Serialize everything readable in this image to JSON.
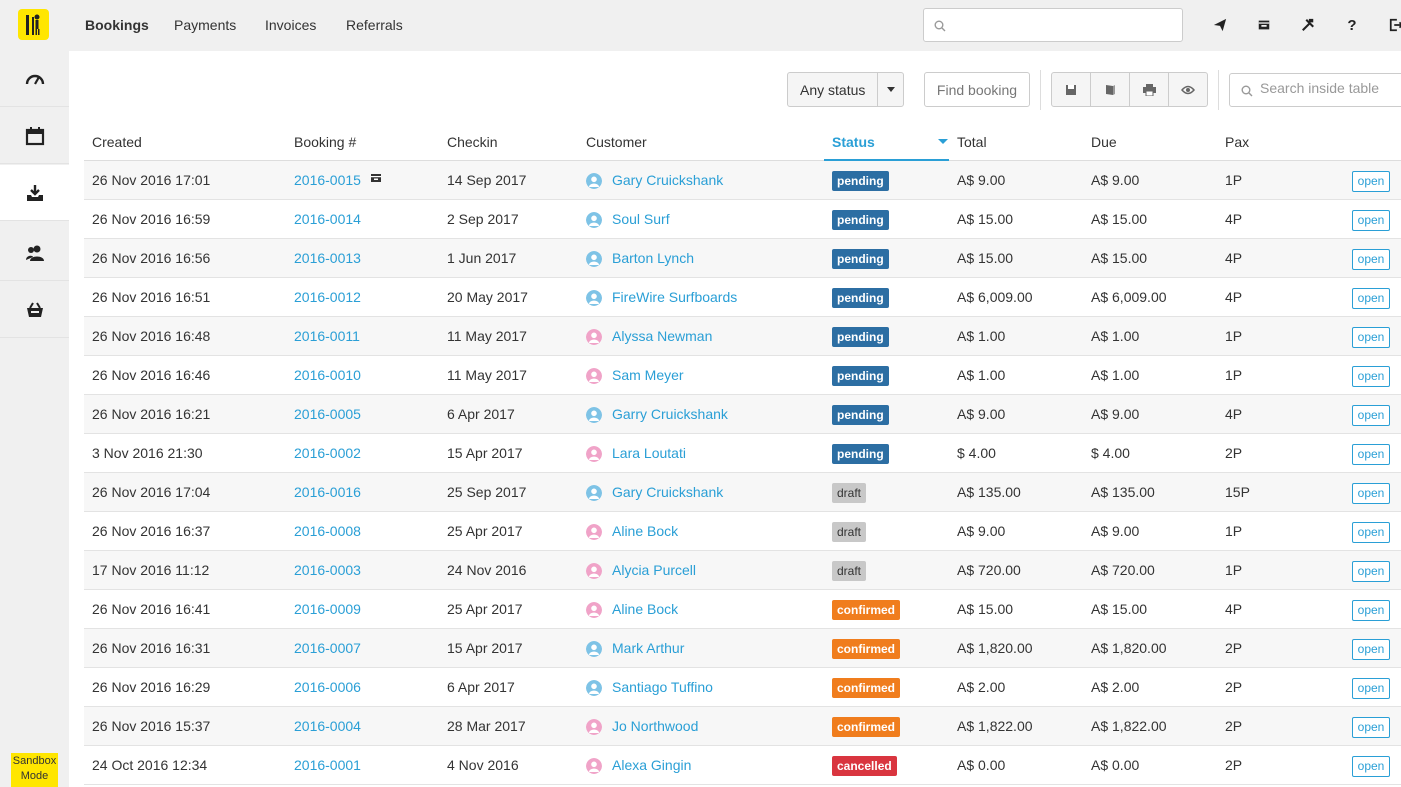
{
  "sidebar": {
    "items": [
      {
        "icon": "dashboard-gauge-icon"
      },
      {
        "icon": "calendar-icon"
      },
      {
        "icon": "inbox-download-icon"
      },
      {
        "icon": "users-icon"
      },
      {
        "icon": "store-basket-icon"
      }
    ],
    "sandbox_line1": "Sandbox",
    "sandbox_line2": "Mode"
  },
  "nav": {
    "tabs": [
      "Bookings",
      "Payments",
      "Invoices",
      "Referrals"
    ],
    "active": "Bookings",
    "help_label": "?"
  },
  "toolbar": {
    "status_filter": "Any status",
    "find_booking": "Find booking",
    "search_placeholder": "Search inside table"
  },
  "table": {
    "columns": [
      "Created",
      "Booking #",
      "Checkin",
      "Customer",
      "Status",
      "Total",
      "Due",
      "Pax"
    ],
    "sorted_column": "Status",
    "rows": [
      {
        "created": "26 Nov 2016  17:01",
        "booking": "2016-0015",
        "checkin": "14 Sep 2017",
        "customer": "Gary Cruickshank",
        "gender": "male",
        "status": "pending",
        "total": "A$ 9.00",
        "due": "A$ 9.00",
        "pax": "1P",
        "action": "open",
        "store_icon": true
      },
      {
        "created": "26 Nov 2016  16:59",
        "booking": "2016-0014",
        "checkin": "2 Sep 2017",
        "customer": "Soul Surf",
        "gender": "male",
        "status": "pending",
        "total": "A$ 15.00",
        "due": "A$ 15.00",
        "pax": "4P",
        "action": "open"
      },
      {
        "created": "26 Nov 2016  16:56",
        "booking": "2016-0013",
        "checkin": "1 Jun 2017",
        "customer": "Barton Lynch",
        "gender": "male",
        "status": "pending",
        "total": "A$ 15.00",
        "due": "A$ 15.00",
        "pax": "4P",
        "action": "open"
      },
      {
        "created": "26 Nov 2016  16:51",
        "booking": "2016-0012",
        "checkin": "20 May 2017",
        "customer": "FireWire Surfboards",
        "gender": "male",
        "status": "pending",
        "total": "A$ 6,009.00",
        "due": "A$ 6,009.00",
        "pax": "4P",
        "action": "open"
      },
      {
        "created": "26 Nov 2016  16:48",
        "booking": "2016-0011",
        "checkin": "11 May 2017",
        "customer": "Alyssa Newman",
        "gender": "female",
        "status": "pending",
        "total": "A$ 1.00",
        "due": "A$ 1.00",
        "pax": "1P",
        "action": "open"
      },
      {
        "created": "26 Nov 2016  16:46",
        "booking": "2016-0010",
        "checkin": "11 May 2017",
        "customer": "Sam Meyer",
        "gender": "female",
        "status": "pending",
        "total": "A$ 1.00",
        "due": "A$ 1.00",
        "pax": "1P",
        "action": "open"
      },
      {
        "created": "26 Nov 2016  16:21",
        "booking": "2016-0005",
        "checkin": "6 Apr 2017",
        "customer": "Garry Cruickshank",
        "gender": "male",
        "status": "pending",
        "total": "A$ 9.00",
        "due": "A$ 9.00",
        "pax": "4P",
        "action": "open"
      },
      {
        "created": "3 Nov 2016  21:30",
        "booking": "2016-0002",
        "checkin": "15 Apr 2017",
        "customer": "Lara Loutati",
        "gender": "female",
        "status": "pending",
        "total": "$ 4.00",
        "due": "$ 4.00",
        "pax": "2P",
        "action": "open"
      },
      {
        "created": "26 Nov 2016  17:04",
        "booking": "2016-0016",
        "checkin": "25 Sep 2017",
        "customer": "Gary Cruickshank",
        "gender": "male",
        "status": "draft",
        "total": "A$ 135.00",
        "due": "A$ 135.00",
        "pax": "15P",
        "action": "open"
      },
      {
        "created": "26 Nov 2016  16:37",
        "booking": "2016-0008",
        "checkin": "25 Apr 2017",
        "customer": "Aline Bock",
        "gender": "female",
        "status": "draft",
        "total": "A$ 9.00",
        "due": "A$ 9.00",
        "pax": "1P",
        "action": "open"
      },
      {
        "created": "17 Nov 2016  11:12",
        "booking": "2016-0003",
        "checkin": "24 Nov 2016",
        "customer": "Alycia Purcell",
        "gender": "female",
        "status": "draft",
        "total": "A$ 720.00",
        "due": "A$ 720.00",
        "pax": "1P",
        "action": "open"
      },
      {
        "created": "26 Nov 2016  16:41",
        "booking": "2016-0009",
        "checkin": "25 Apr 2017",
        "customer": "Aline Bock",
        "gender": "female",
        "status": "confirmed",
        "total": "A$ 15.00",
        "due": "A$ 15.00",
        "pax": "4P",
        "action": "open"
      },
      {
        "created": "26 Nov 2016  16:31",
        "booking": "2016-0007",
        "checkin": "15 Apr 2017",
        "customer": "Mark Arthur",
        "gender": "male",
        "status": "confirmed",
        "total": "A$ 1,820.00",
        "due": "A$ 1,820.00",
        "pax": "2P",
        "action": "open"
      },
      {
        "created": "26 Nov 2016  16:29",
        "booking": "2016-0006",
        "checkin": "6 Apr 2017",
        "customer": "Santiago Tuffino",
        "gender": "male",
        "status": "confirmed",
        "total": "A$ 2.00",
        "due": "A$ 2.00",
        "pax": "2P",
        "action": "open"
      },
      {
        "created": "26 Nov 2016  15:37",
        "booking": "2016-0004",
        "checkin": "28 Mar 2017",
        "customer": "Jo Northwood",
        "gender": "female",
        "status": "confirmed",
        "total": "A$ 1,822.00",
        "due": "A$ 1,822.00",
        "pax": "2P",
        "action": "open"
      },
      {
        "created": "24 Oct 2016  12:34",
        "booking": "2016-0001",
        "checkin": "4 Nov 2016",
        "customer": "Alexa Gingin",
        "gender": "female",
        "status": "cancelled",
        "total": "A$ 0.00",
        "due": "A$ 0.00",
        "pax": "2P",
        "action": "open"
      }
    ]
  },
  "colors": {
    "accent": "#2a9fd6",
    "brand_yellow": "#ffe600",
    "pending": "#2c6ea3",
    "draft": "#c8c8c8",
    "confirmed": "#f07d1d",
    "cancelled": "#d9353f",
    "avatar_male": "#7ec3e6",
    "avatar_female": "#f0a3c8"
  }
}
